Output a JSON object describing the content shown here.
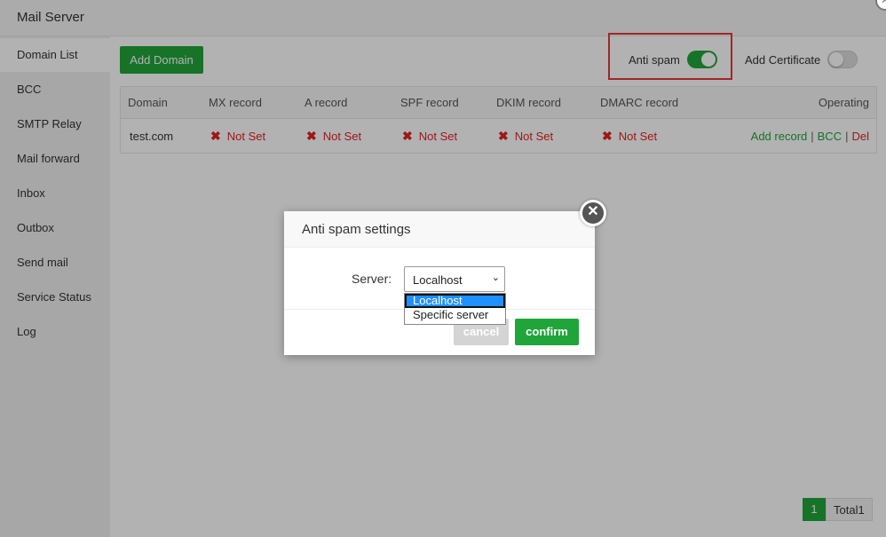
{
  "window": {
    "title": "Mail Server"
  },
  "sidebar": {
    "items": [
      {
        "label": "Domain List"
      },
      {
        "label": "BCC"
      },
      {
        "label": "SMTP Relay"
      },
      {
        "label": "Mail forward"
      },
      {
        "label": "Inbox"
      },
      {
        "label": "Outbox"
      },
      {
        "label": "Send mail"
      },
      {
        "label": "Service Status"
      },
      {
        "label": "Log"
      }
    ]
  },
  "toolbar": {
    "add_domain_label": "Add Domain",
    "anti_spam": {
      "label": "Anti spam",
      "on": true
    },
    "add_certificate": {
      "label": "Add Certificate",
      "on": false
    }
  },
  "table": {
    "headers": [
      "Domain",
      "MX record",
      "A record",
      "SPF record",
      "DKIM record",
      "DMARC record",
      "Operating"
    ],
    "rows": [
      {
        "domain": "test.com",
        "mx": "Not Set",
        "a": "Not Set",
        "spf": "Not Set",
        "dkim": "Not Set",
        "dmarc": "Not Set",
        "actions": {
          "add_record": "Add record",
          "bcc": "BCC",
          "del": "Del",
          "sep": "|"
        }
      }
    ]
  },
  "pagination": {
    "current": "1",
    "total": "Total1"
  },
  "modal": {
    "title": "Anti spam settings",
    "server_label": "Server:",
    "server_value": "Localhost",
    "options": [
      "Localhost",
      "Specific server"
    ],
    "cancel_label": "cancel",
    "confirm_label": "confirm"
  },
  "colors": {
    "accent": "#20a53a",
    "danger": "#e52020",
    "highlight": "#e53935"
  },
  "icons": {
    "close": "close-icon",
    "error": "x-mark-icon",
    "chevron": "chevron-down-icon"
  }
}
